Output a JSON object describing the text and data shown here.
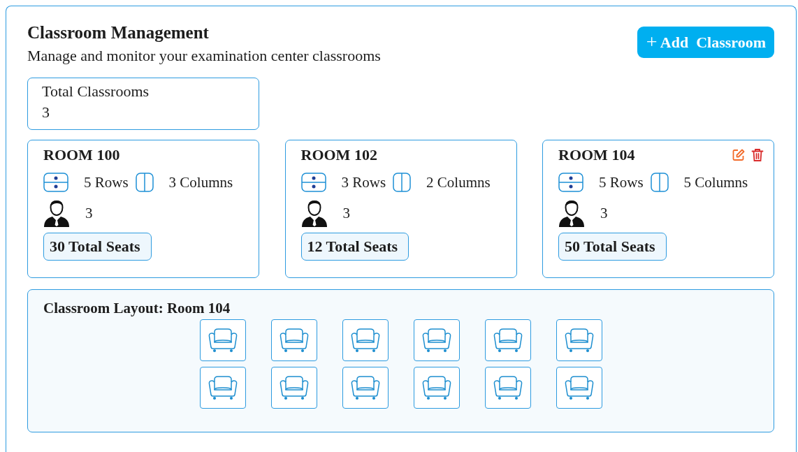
{
  "header": {
    "title": "Classroom Management",
    "subtitle": "Manage and monitor your examination center classrooms"
  },
  "add_button": {
    "icon": "+",
    "label": "Add  Classroom"
  },
  "summary": {
    "label": "Total Classrooms",
    "value": "3"
  },
  "rooms": [
    {
      "name": "ROOM 100",
      "rows": "5 Rows",
      "columns": "3 Columns",
      "invigilators": "3",
      "seats": "30 Total Seats"
    },
    {
      "name": "ROOM 102",
      "rows": "3 Rows",
      "columns": "2 Columns",
      "invigilators": "3",
      "seats": "12 Total Seats"
    },
    {
      "name": "ROOM 104",
      "rows": "5 Rows",
      "columns": "5 Columns",
      "invigilators": "3",
      "seats": "50 Total Seats",
      "actions": [
        {
          "kind": "edit"
        },
        {
          "kind": "delete"
        }
      ]
    }
  ],
  "layout": {
    "title": "Classroom Layout: Room 104",
    "seat_rows": [
      {
        "seats": [
          {
            "kind": "chair"
          },
          {
            "kind": "chair"
          },
          {
            "kind": "chair"
          },
          {
            "kind": "chair"
          },
          {
            "kind": "chair"
          },
          {
            "kind": "chair"
          }
        ]
      },
      {
        "seats": [
          {
            "kind": "chair"
          },
          {
            "kind": "chair"
          },
          {
            "kind": "chair"
          },
          {
            "kind": "chair"
          },
          {
            "kind": "chair"
          },
          {
            "kind": "chair"
          }
        ]
      }
    ]
  }
}
